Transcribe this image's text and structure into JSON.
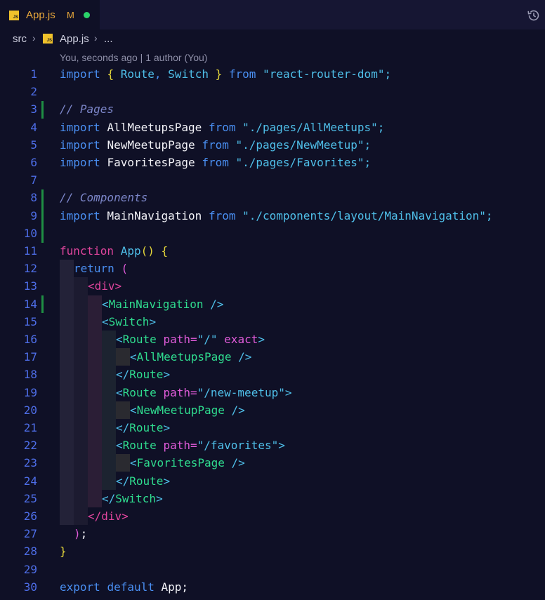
{
  "tab": {
    "title": "App.js",
    "modified": "M",
    "icon": "js-file-icon",
    "lang_badge": "JS"
  },
  "breadcrumb": {
    "folder": "src",
    "file": "App.js",
    "more": "..."
  },
  "blame": "You, seconds ago | 1 author (You)",
  "line_numbers": [
    "1",
    "2",
    "3",
    "4",
    "5",
    "6",
    "7",
    "8",
    "9",
    "10",
    "11",
    "12",
    "13",
    "14",
    "15",
    "16",
    "17",
    "18",
    "19",
    "20",
    "21",
    "22",
    "23",
    "24",
    "25",
    "26",
    "27",
    "28",
    "29",
    "30"
  ],
  "code": {
    "l1": {
      "a": "import",
      "b": "{",
      "c": "Route",
      "d": ",",
      "e": "Switch",
      "f": "}",
      "g": "from",
      "h": "\"react-router-dom\"",
      "i": ";"
    },
    "l3": "// Pages",
    "l4": {
      "a": "import",
      "b": "AllMeetupsPage",
      "c": "from",
      "d": "\"./pages/AllMeetups\"",
      "e": ";"
    },
    "l5": {
      "a": "import",
      "b": "NewMeetupPage",
      "c": "from",
      "d": "\"./pages/NewMeetup\"",
      "e": ";"
    },
    "l6": {
      "a": "import",
      "b": "FavoritesPage",
      "c": "from",
      "d": "\"./pages/Favorites\"",
      "e": ";"
    },
    "l8": "// Components",
    "l9": {
      "a": "import",
      "b": "MainNavigation",
      "c": "from",
      "d": "\"./components/layout/MainNavigation\"",
      "e": ";"
    },
    "l11": {
      "a": "function",
      "b": "App",
      "c": "()",
      "d": "{"
    },
    "l12": {
      "a": "return",
      "b": "("
    },
    "l13": {
      "a": "<",
      "b": "div",
      "c": ">"
    },
    "l14": {
      "a": "<",
      "b": "MainNavigation",
      "c": "/>"
    },
    "l15": {
      "a": "<",
      "b": "Switch",
      "c": ">"
    },
    "l16": {
      "a": "<",
      "b": "Route",
      "c": "path",
      "d": "=",
      "e": "\"/\"",
      "f": "exact",
      "g": ">"
    },
    "l17": {
      "a": "<",
      "b": "AllMeetupsPage",
      "c": "/>"
    },
    "l18": {
      "a": "</",
      "b": "Route",
      "c": ">"
    },
    "l19": {
      "a": "<",
      "b": "Route",
      "c": "path",
      "d": "=",
      "e": "\"/new-meetup\"",
      "g": ">"
    },
    "l20": {
      "a": "<",
      "b": "NewMeetupPage",
      "c": "/>"
    },
    "l21": {
      "a": "</",
      "b": "Route",
      "c": ">"
    },
    "l22": {
      "a": "<",
      "b": "Route",
      "c": "path",
      "d": "=",
      "e": "\"/favorites\"",
      "g": ">"
    },
    "l23": {
      "a": "<",
      "b": "FavoritesPage",
      "c": "/>"
    },
    "l24": {
      "a": "</",
      "b": "Route",
      "c": ">"
    },
    "l25": {
      "a": "</",
      "b": "Switch",
      "c": ">"
    },
    "l26": {
      "a": "</",
      "b": "div",
      "c": ">"
    },
    "l27": {
      "a": ")",
      "b": ";"
    },
    "l28": "}",
    "l30": {
      "a": "export",
      "b": "default",
      "c": "App",
      "d": ";"
    }
  },
  "colors": {
    "background": "#0f1026",
    "line_number": "#4e6ee8",
    "modified": "#e9a83b",
    "added": "#1f8f44"
  }
}
